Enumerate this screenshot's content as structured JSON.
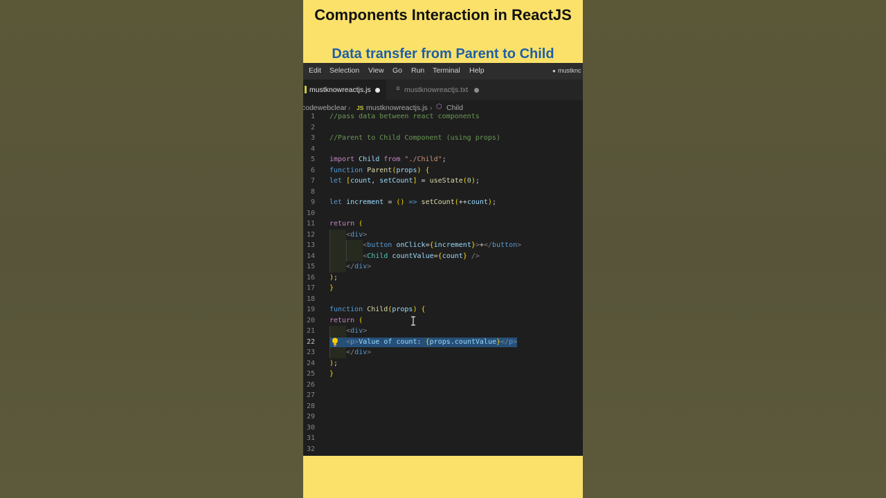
{
  "video": {
    "title": "Components Interaction in ReactJS",
    "subtitle": "Data transfer from Parent to Child"
  },
  "menu": {
    "items": [
      "Edit",
      "Selection",
      "View",
      "Go",
      "Run",
      "Terminal",
      "Help"
    ],
    "window_title": "mustknc"
  },
  "tabs": [
    {
      "label": "mustknowreactjs.js",
      "state": "modified"
    },
    {
      "label": "mustknowreactjs.txt",
      "state": "modified"
    }
  ],
  "breadcrumb": {
    "folder": "codewebclear",
    "file_badge": "JS",
    "file": "mustknowreactjs.js",
    "symbol": "Child"
  },
  "editor": {
    "current_line": 22,
    "lines": [
      "//pass data between react components",
      "",
      "//Parent to Child Component (using props)",
      "",
      "import Child from \"./Child\";",
      "function Parent(props) {",
      "let [count, setCount] = useState(0);",
      "",
      "let increment = () => setCount(++count);",
      "",
      "return (",
      "    <div>",
      "        <button onClick={increment}>+</button>",
      "        <Child countValue={count} />",
      "    </div>",
      ");",
      "}",
      "",
      "function Child(props) {",
      "return (",
      "    <div>",
      "    <p>Value of count: {props.countValue}</p>",
      "    </div>",
      ");",
      "}",
      "",
      "",
      "",
      "",
      "",
      "",
      ""
    ]
  },
  "colors": {
    "accent_yellow": "#fbe16a",
    "subtitle_blue": "#1f5fa5",
    "editor_bg": "#1e1e1e",
    "selection": "#264f78"
  }
}
